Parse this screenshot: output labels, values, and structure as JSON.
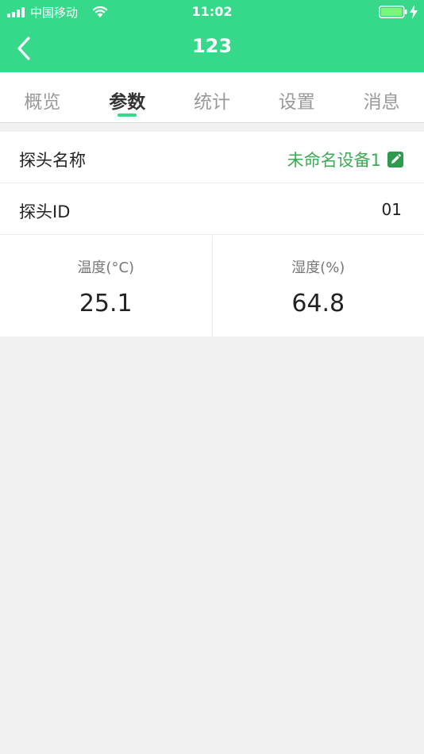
{
  "status_bar": {
    "carrier": "中国移动",
    "time": "11:02"
  },
  "nav": {
    "title": "123"
  },
  "tabs": [
    {
      "label": "概览",
      "active": false
    },
    {
      "label": "参数",
      "active": true
    },
    {
      "label": "统计",
      "active": false
    },
    {
      "label": "设置",
      "active": false
    },
    {
      "label": "消息",
      "active": false
    }
  ],
  "probe": {
    "name_label": "探头名称",
    "name_value": "未命名设备1",
    "id_label": "探头ID",
    "id_value": "01"
  },
  "metrics": {
    "temperature": {
      "label": "温度(°C)",
      "value": "25.1"
    },
    "humidity": {
      "label": "湿度(%)",
      "value": "64.8"
    }
  },
  "colors": {
    "brand": "#36d98a",
    "edit_icon": "#2e9a4e",
    "link_text": "#3daa55",
    "background": "#f0f0f0"
  },
  "icons": [
    "signal-icon",
    "wifi-icon",
    "battery-icon",
    "charging-icon",
    "back-arrow-icon",
    "edit-icon"
  ]
}
